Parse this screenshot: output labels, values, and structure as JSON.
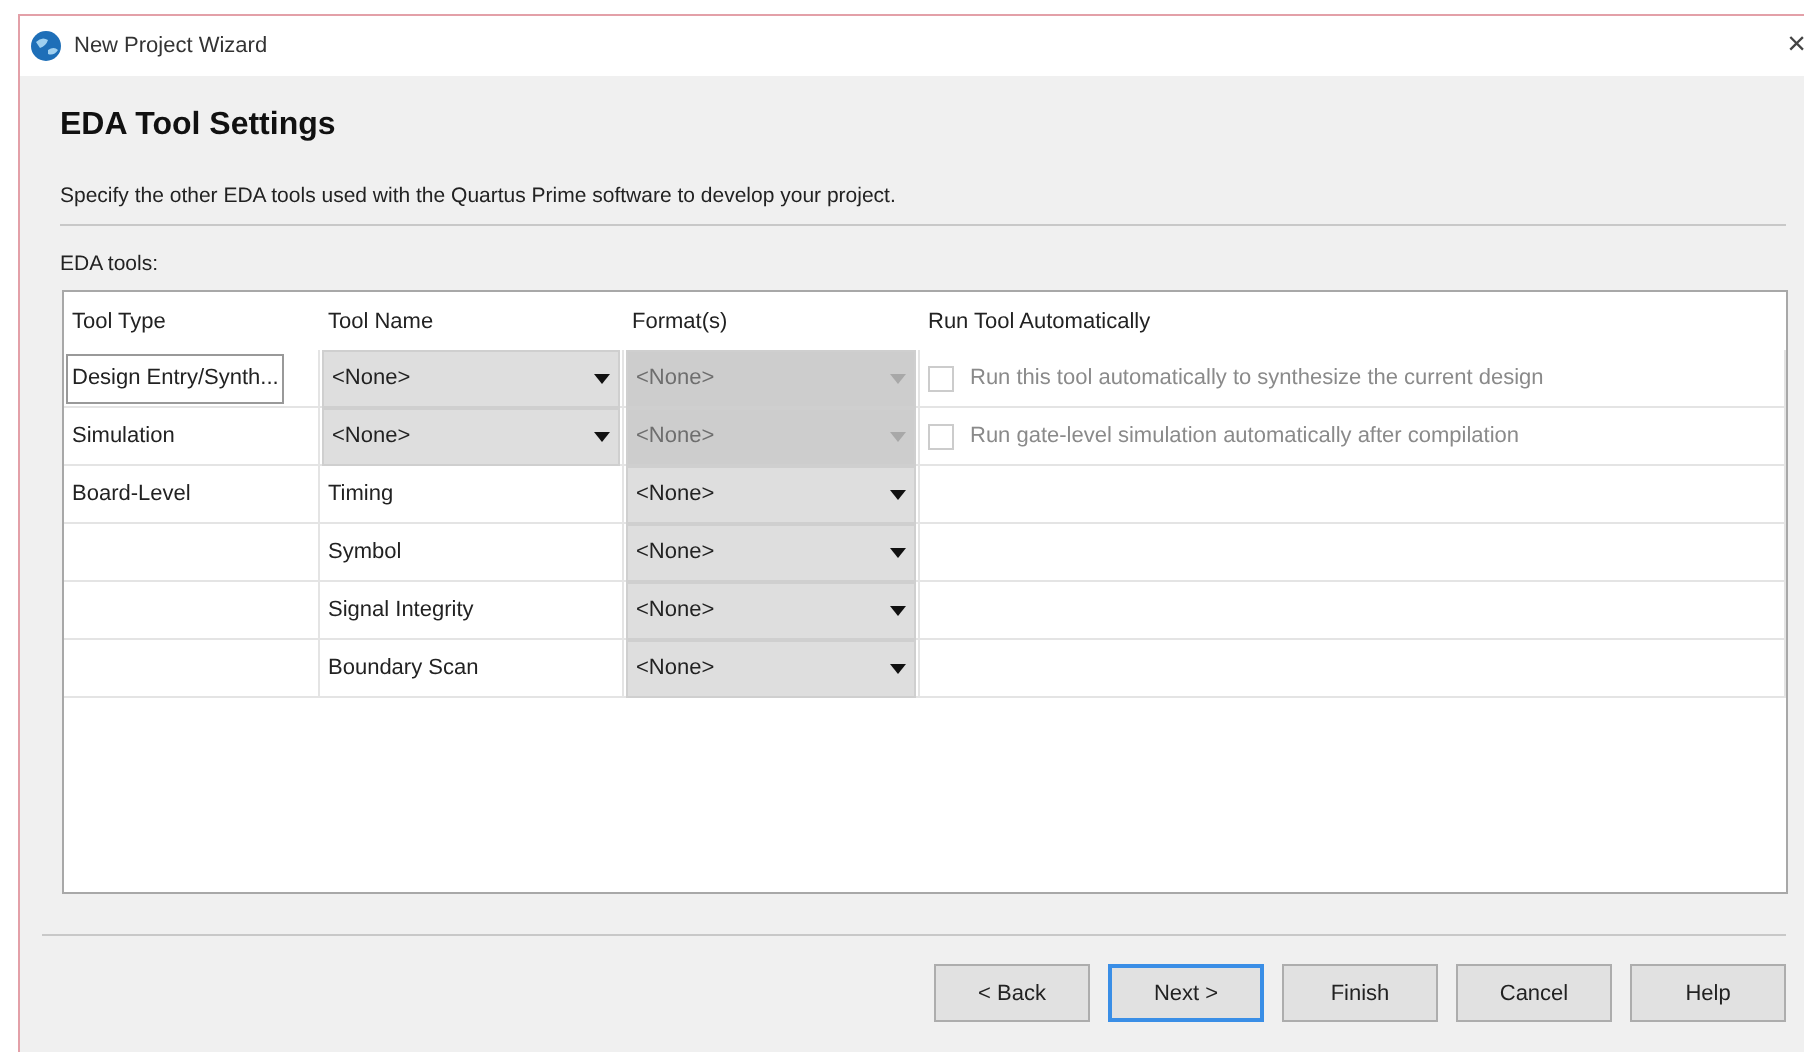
{
  "window": {
    "title": "New Project Wizard",
    "close": "×"
  },
  "heading": "EDA Tool Settings",
  "description": "Specify the other EDA tools used with the Quartus Prime software to develop your project.",
  "table_label": "EDA tools:",
  "table": {
    "columns": [
      "Tool Type",
      "Tool Name",
      "Format(s)",
      "Run Tool Automatically"
    ],
    "rows": [
      {
        "kind": "dropdown",
        "tool_type": "Design Entry/Synth...",
        "focused": true,
        "tool_name": {
          "value": "<None>",
          "disabled": false
        },
        "format": {
          "value": "<None>",
          "disabled": true
        },
        "run": {
          "label": "Run this tool automatically to synthesize the current design",
          "checked": false,
          "disabled": true
        }
      },
      {
        "kind": "dropdown",
        "tool_type": "Simulation",
        "tool_name": {
          "value": "<None>",
          "disabled": false
        },
        "format": {
          "value": "<None>",
          "disabled": true
        },
        "run": {
          "label": "Run gate-level simulation automatically after compilation",
          "checked": false,
          "disabled": true
        }
      },
      {
        "kind": "text",
        "tool_type": "Board-Level",
        "tool_name": "Timing",
        "format": {
          "value": "<None>",
          "disabled": false
        }
      },
      {
        "kind": "text",
        "tool_name": "Symbol",
        "format": {
          "value": "<None>",
          "disabled": false
        }
      },
      {
        "kind": "text",
        "tool_name": "Signal Integrity",
        "format": {
          "value": "<None>",
          "disabled": false
        }
      },
      {
        "kind": "text",
        "tool_name": "Boundary Scan",
        "format": {
          "value": "<None>",
          "disabled": false
        }
      }
    ]
  },
  "buttons": [
    {
      "label": "< Back",
      "default": false
    },
    {
      "label": "Next >",
      "default": true
    },
    {
      "label": "Finish",
      "default": false
    },
    {
      "label": "Cancel",
      "default": false
    },
    {
      "label": "Help",
      "default": false
    }
  ]
}
